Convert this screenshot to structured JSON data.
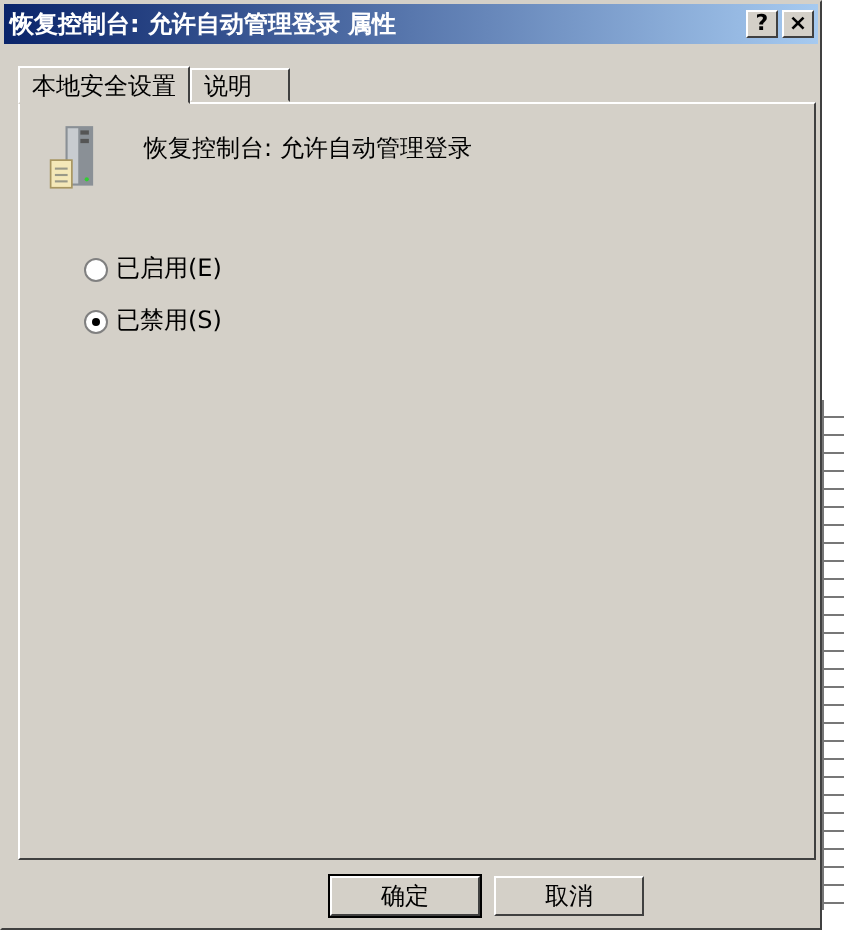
{
  "window": {
    "title": "恢复控制台: 允许自动管理登录 属性",
    "title_buttons": [
      "?",
      "×"
    ]
  },
  "tabs": [
    {
      "label": "本地安全设置",
      "selected": true
    },
    {
      "label": "说明",
      "selected": false
    }
  ],
  "policy": {
    "name": "恢复控制台: 允许自动管理登录"
  },
  "options": [
    {
      "label": "已启用(E)",
      "selected": false
    },
    {
      "label": "已禁用(S)",
      "selected": true
    }
  ],
  "buttons": [
    "确定",
    "取消"
  ]
}
